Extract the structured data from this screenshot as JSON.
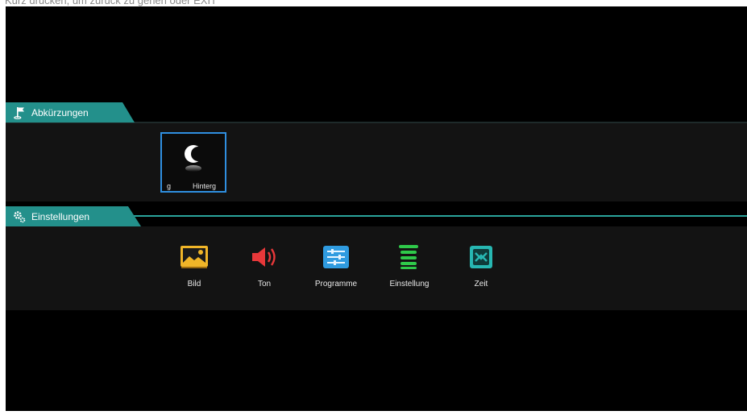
{
  "top_hint": "Kurz drücken, um zurück zu gehen oder EXIT",
  "sections": {
    "shortcuts": {
      "title": "Abkürzungen",
      "icon": "flag-icon",
      "items": [
        {
          "label_left": "g",
          "label_right": "Hinterg",
          "icon": "moon-icon",
          "selected": true,
          "accent": "#2f8fe0"
        }
      ]
    },
    "settings": {
      "title": "Einstellungen",
      "icon": "gears-icon",
      "items": [
        {
          "label": "Bild",
          "icon": "picture-icon",
          "color": "#e2a21b"
        },
        {
          "label": "Ton",
          "icon": "speaker-icon",
          "color": "#e23b3b"
        },
        {
          "label": "Programme",
          "icon": "channel-list-icon",
          "color": "#2f9be0"
        },
        {
          "label": "Einstellung",
          "icon": "settings-list-icon",
          "color": "#2fc94a"
        },
        {
          "label": "Zeit",
          "icon": "clock-icon",
          "color": "#27b7b2"
        }
      ]
    }
  },
  "colors": {
    "tab": "#23908b",
    "accent_line": "#2aa39b",
    "focus": "#2f8fe0",
    "background": "#000000"
  }
}
